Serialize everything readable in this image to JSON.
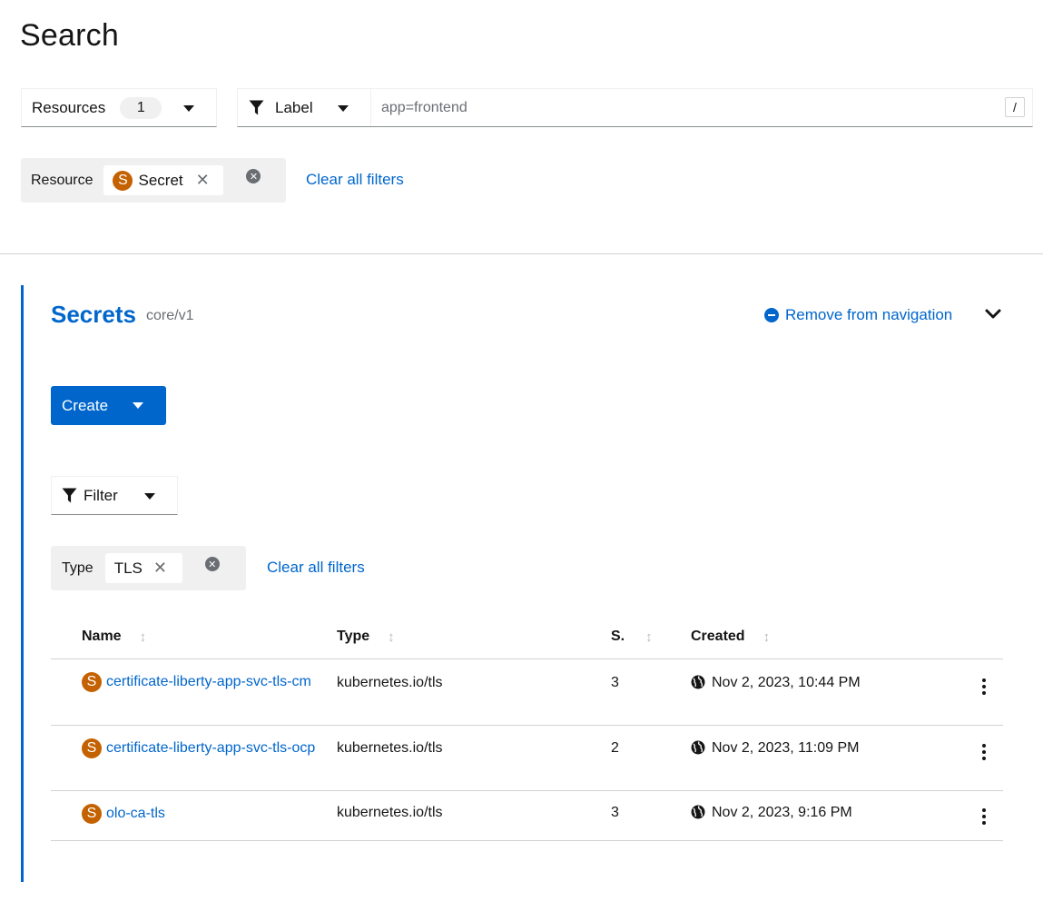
{
  "page": {
    "title": "Search"
  },
  "toolbar": {
    "resources_label": "Resources",
    "resources_count": "1",
    "label_dropdown": "Label",
    "label_input_value": "app=frontend",
    "shortcut_hint": "/"
  },
  "search_filters": {
    "category": "Resource",
    "chip_badge": "S",
    "chip_label": "Secret",
    "clear_all": "Clear all filters"
  },
  "section": {
    "title": "Secrets",
    "api_version": "core/v1",
    "remove_nav": "Remove from navigation",
    "create_button": "Create",
    "filter_dropdown": "Filter",
    "type_filter": {
      "category": "Type",
      "chip_label": "TLS",
      "clear_all": "Clear all filters"
    }
  },
  "table": {
    "columns": [
      "Name",
      "Type",
      "S.",
      "Created"
    ],
    "rows": [
      {
        "badge": "S",
        "name": "certificate-liberty-app-svc-tls-cm",
        "type": "kubernetes.io/tls",
        "size": "3",
        "created": "Nov 2, 2023, 10:44 PM"
      },
      {
        "badge": "S",
        "name": "certificate-liberty-app-svc-tls-ocp",
        "type": "kubernetes.io/tls",
        "size": "2",
        "created": "Nov 2, 2023, 11:09 PM"
      },
      {
        "badge": "S",
        "name": "olo-ca-tls",
        "type": "kubernetes.io/tls",
        "size": "3",
        "created": "Nov 2, 2023, 9:16 PM"
      }
    ]
  },
  "colors": {
    "link": "#0066cc",
    "resource_badge": "#c46100",
    "primary_button": "#0066cc"
  },
  "icons": [
    "filter-icon",
    "caret-down-icon",
    "close-icon",
    "close-circle-icon",
    "minus-circle-icon",
    "chevron-down-icon",
    "sort-icon",
    "globe-icon",
    "kebab-icon"
  ]
}
